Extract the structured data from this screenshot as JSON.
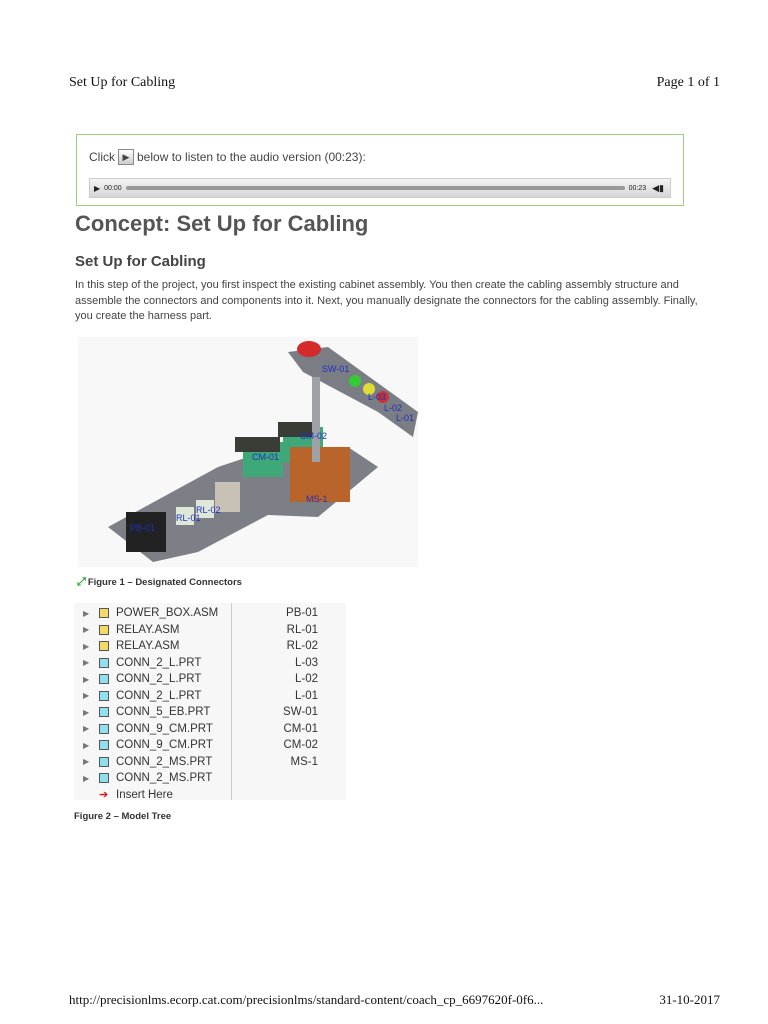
{
  "header": {
    "title": "Set Up for Cabling",
    "page": "Page 1 of 1"
  },
  "audio": {
    "prefix": "Click",
    "suffix": "below to listen to the audio version (00:23):",
    "time_start": "00:00",
    "time_end": "00:23"
  },
  "content": {
    "title": "Concept: Set Up for Cabling",
    "subtitle": "Set Up for Cabling",
    "paragraph": "In this step of the project, you first inspect the existing cabinet assembly. You then create the cabling assembly structure and assemble the connectors and components into it. Next, you manually designate the connectors for the cabling assembly. Finally, you create the harness part."
  },
  "figure1": {
    "caption": "Figure 1 – Designated Connectors",
    "labels": [
      "SW-01",
      "L-03",
      "L-02",
      "L-01",
      "CM-02",
      "CM-01",
      "MS-1",
      "RL-02",
      "RL-01",
      "PB-01"
    ]
  },
  "figure2": {
    "caption": "Figure 2 – Model Tree",
    "rows": [
      {
        "name": "POWER_BOX.ASM",
        "designation": "PB-01",
        "type": "asm"
      },
      {
        "name": "RELAY.ASM",
        "designation": "RL-01",
        "type": "asm"
      },
      {
        "name": "RELAY.ASM",
        "designation": "RL-02",
        "type": "asm"
      },
      {
        "name": "CONN_2_L.PRT",
        "designation": "L-03",
        "type": "prt"
      },
      {
        "name": "CONN_2_L.PRT",
        "designation": "L-02",
        "type": "prt"
      },
      {
        "name": "CONN_2_L.PRT",
        "designation": "L-01",
        "type": "prt"
      },
      {
        "name": "CONN_5_EB.PRT",
        "designation": "SW-01",
        "type": "prt"
      },
      {
        "name": "CONN_9_CM.PRT",
        "designation": "CM-01",
        "type": "prt"
      },
      {
        "name": "CONN_9_CM.PRT",
        "designation": "CM-02",
        "type": "prt"
      },
      {
        "name": "CONN_2_MS.PRT",
        "designation": "MS-1",
        "type": "prt"
      },
      {
        "name": "CONN_2_MS.PRT",
        "designation": "",
        "type": "prt"
      }
    ],
    "insert": "Insert Here"
  },
  "footer": {
    "url": "http://precisionlms.ecorp.cat.com/precisionlms/standard-content/coach_cp_6697620f-0f6...",
    "date": "31-10-2017"
  }
}
